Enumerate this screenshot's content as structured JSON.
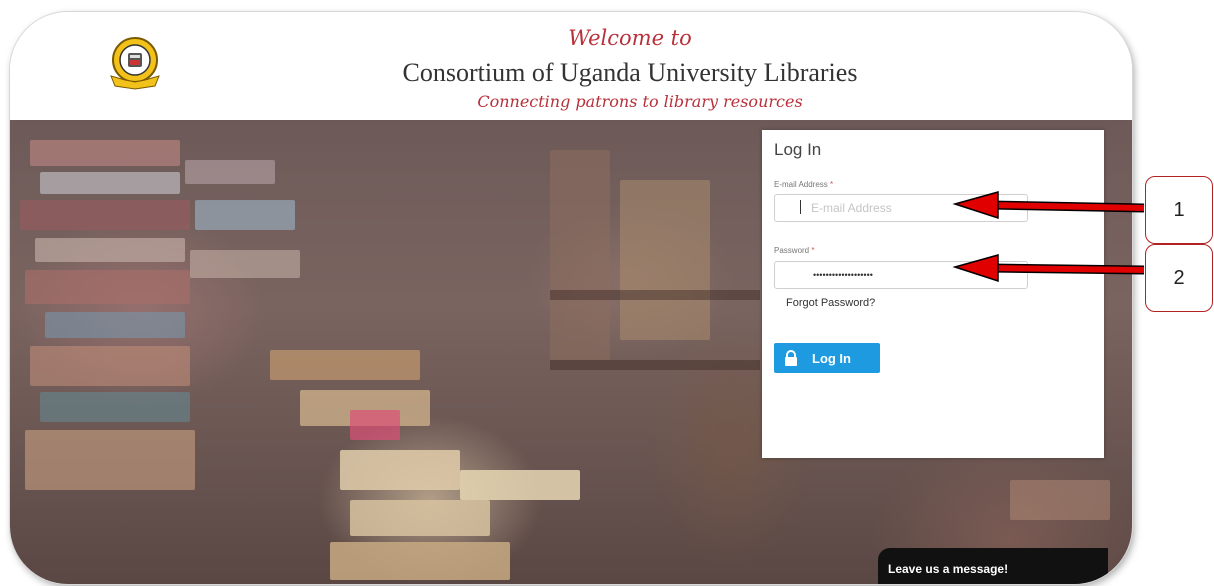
{
  "header": {
    "welcome": "Welcome to",
    "title": "Consortium of Uganda University Libraries",
    "tagline": "Connecting patrons to library resources",
    "logo_icon": "university-seal-logo"
  },
  "login": {
    "title": "Log In",
    "email_label": "E-mail Address",
    "email_placeholder": "E-mail Address",
    "email_value": "",
    "password_label": "Password",
    "password_value": "•••••••••••••••••••",
    "required_mark": "*",
    "forgot_password": "Forgot Password?",
    "login_button": "Log In",
    "button_color": "#1e9be0"
  },
  "chat_widget": {
    "label": "Leave us a message!"
  },
  "annotations": {
    "callout_1": "1",
    "callout_2": "2",
    "arrow_color": "#e00000"
  }
}
